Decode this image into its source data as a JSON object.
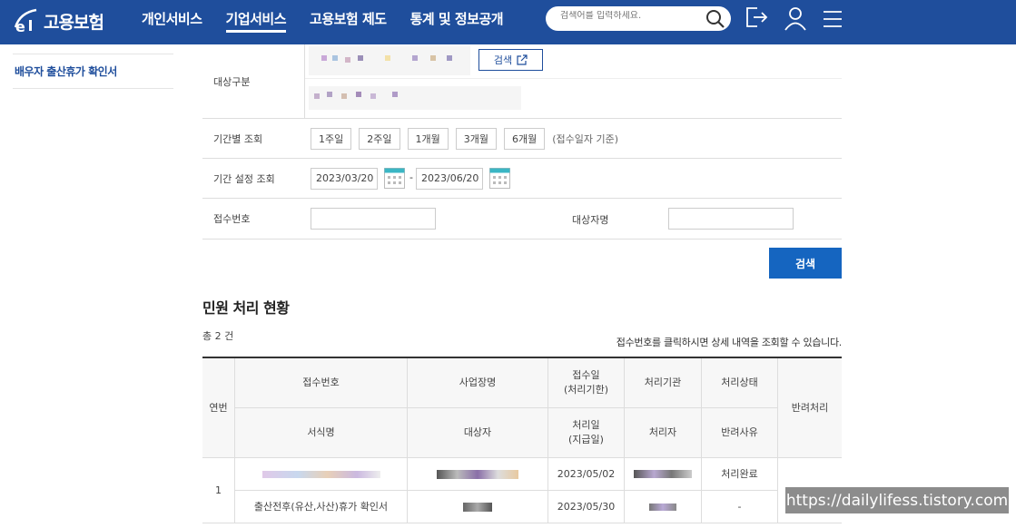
{
  "header": {
    "logo_text": "고용보험",
    "nav": [
      "개인서비스",
      "기업서비스",
      "고용보험 제도",
      "통계 및 정보공개"
    ],
    "active_nav": 1,
    "search_placeholder": "검색어를 입력하세요.",
    "brand_color": "#1f4e9c"
  },
  "sidebar": {
    "items": [
      {
        "label": "배우자 출산휴가 확인서"
      }
    ]
  },
  "form": {
    "target_label": "대상구분",
    "target_search_btn": "검색",
    "period_label": "기간별 조회",
    "period_buttons": [
      "1주일",
      "2주일",
      "1개월",
      "3개월",
      "6개월"
    ],
    "period_note": "(접수일자 기준)",
    "range_label": "기간 설정 조회",
    "date_from": "2023/03/20",
    "date_sep": "-",
    "date_to": "2023/06/20",
    "receipt_label": "접수번호",
    "target_name_label": "대상자명",
    "search_btn": "검색"
  },
  "results": {
    "title": "민원 처리 현황",
    "total": "총 2 건",
    "hint": "접수번호를 클릭하시면 상세 내역을 조회할 수 있습니다.",
    "headers": {
      "no": "연번",
      "receipt_no": "접수번호",
      "company": "사업장명",
      "receipt_date": "접수일\n(처리기한)",
      "agency": "처리기관",
      "status": "처리상태",
      "reject": "반려처리",
      "form_name": "서식명",
      "target": "대상자",
      "process_date": "처리일\n(지급일)",
      "handler": "처리자",
      "reject_reason": "반려사유"
    },
    "rows": [
      {
        "no": "1",
        "receipt_date": "2023/05/02",
        "status": "처리완료",
        "form_name": "출산전후(유산,사산)휴가 확인서",
        "process_date": "2023/05/30",
        "reject_reason": "-"
      }
    ]
  },
  "watermark": "https://dailylifess.tistory.com",
  "icons": [
    "search-icon",
    "logout-icon",
    "user-icon",
    "menu-icon",
    "calendar-icon",
    "external-link-icon"
  ]
}
